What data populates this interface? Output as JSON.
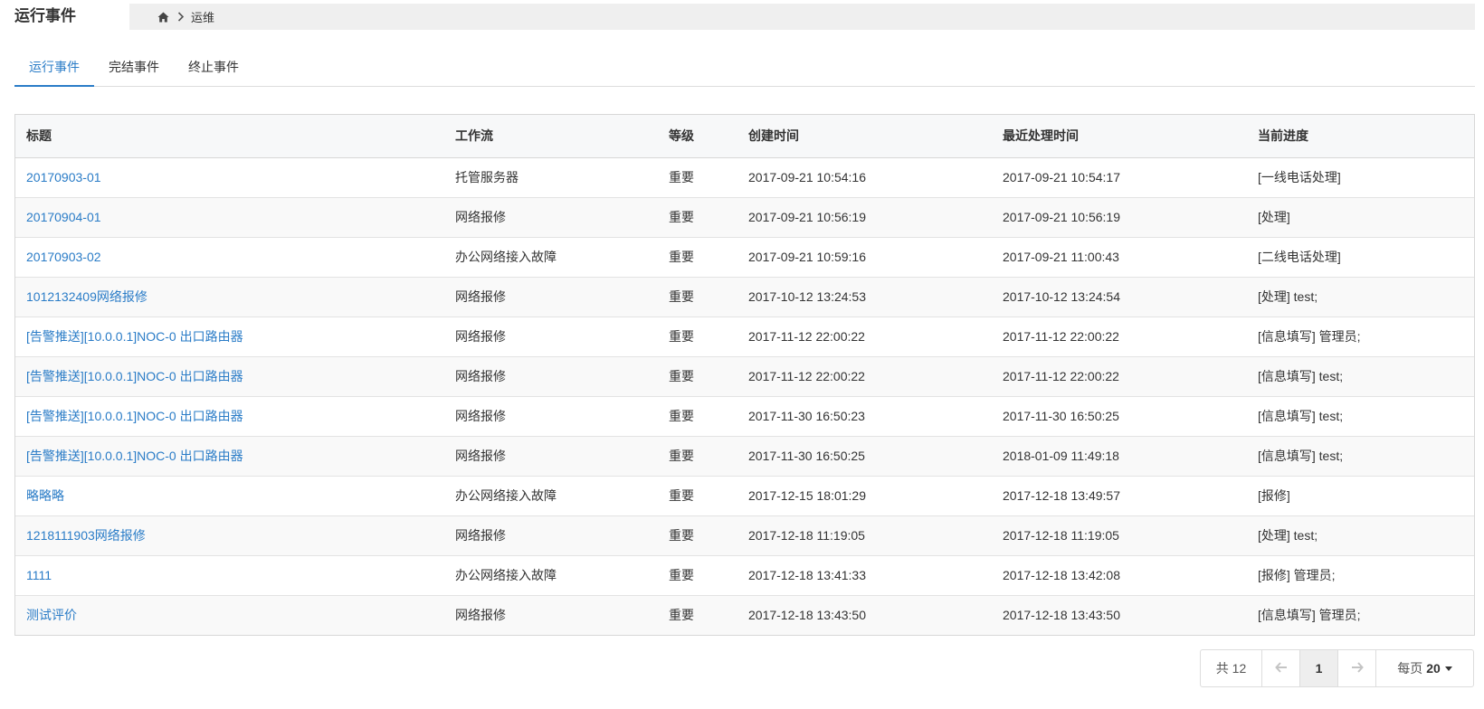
{
  "header": {
    "title": "运行事件",
    "breadcrumb": {
      "home_icon": "home-icon",
      "current": "运维"
    }
  },
  "tabs": [
    {
      "label": "运行事件",
      "active": true
    },
    {
      "label": "完结事件",
      "active": false
    },
    {
      "label": "终止事件",
      "active": false
    }
  ],
  "table": {
    "columns": [
      "标题",
      "工作流",
      "等级",
      "创建时间",
      "最近处理时间",
      "当前进度"
    ],
    "rows": [
      [
        "20170903-01",
        "托管服务器",
        "重要",
        "2017-09-21 10:54:16",
        "2017-09-21 10:54:17",
        "[一线电话处理]"
      ],
      [
        "20170904-01",
        "网络报修",
        "重要",
        "2017-09-21 10:56:19",
        "2017-09-21 10:56:19",
        "[处理]"
      ],
      [
        "20170903-02",
        "办公网络接入故障",
        "重要",
        "2017-09-21 10:59:16",
        "2017-09-21 11:00:43",
        "[二线电话处理]"
      ],
      [
        "1012132409网络报修",
        "网络报修",
        "重要",
        "2017-10-12 13:24:53",
        "2017-10-12 13:24:54",
        "[处理] test;"
      ],
      [
        "[告警推送][10.0.0.1]NOC-0 出口路由器",
        "网络报修",
        "重要",
        "2017-11-12 22:00:22",
        "2017-11-12 22:00:22",
        "[信息填写] 管理员;"
      ],
      [
        "[告警推送][10.0.0.1]NOC-0 出口路由器",
        "网络报修",
        "重要",
        "2017-11-12 22:00:22",
        "2017-11-12 22:00:22",
        "[信息填写] test;"
      ],
      [
        "[告警推送][10.0.0.1]NOC-0 出口路由器",
        "网络报修",
        "重要",
        "2017-11-30 16:50:23",
        "2017-11-30 16:50:25",
        "[信息填写] test;"
      ],
      [
        "[告警推送][10.0.0.1]NOC-0 出口路由器",
        "网络报修",
        "重要",
        "2017-11-30 16:50:25",
        "2018-01-09 11:49:18",
        "[信息填写] test;"
      ],
      [
        "略略略",
        "办公网络接入故障",
        "重要",
        "2017-12-15 18:01:29",
        "2017-12-18 13:49:57",
        "[报修]"
      ],
      [
        "1218111903网络报修",
        "网络报修",
        "重要",
        "2017-12-18 11:19:05",
        "2017-12-18 11:19:05",
        "[处理] test;"
      ],
      [
        "1111",
        "办公网络接入故障",
        "重要",
        "2017-12-18 13:41:33",
        "2017-12-18 13:42:08",
        "[报修] 管理员;"
      ],
      [
        "测试评价",
        "网络报修",
        "重要",
        "2017-12-18 13:43:50",
        "2017-12-18 13:43:50",
        "[信息填写] 管理员;"
      ]
    ]
  },
  "pager": {
    "total_label": "共 12",
    "prev_icon": "arrow-left-icon",
    "current_page": "1",
    "next_icon": "arrow-right-icon",
    "page_size_label": "每页",
    "page_size_value": "20"
  },
  "colors": {
    "accent": "#2a7cc7",
    "border": "#d7d7d7",
    "header_bg": "#f7f8f9"
  }
}
